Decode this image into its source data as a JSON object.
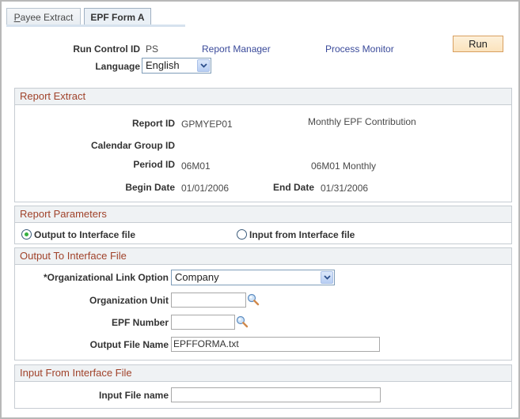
{
  "tabs": [
    {
      "label_prefix": "P",
      "label_rest": "ayee Extract",
      "active": false
    },
    {
      "label": "EPF Form A",
      "active": true
    }
  ],
  "header": {
    "run_control_label": "Run Control ID",
    "run_control_value": "PS",
    "report_manager_link": "Report Manager",
    "process_monitor_link": "Process Monitor",
    "language_label": "Language",
    "language_value": "English",
    "run_button": "Run"
  },
  "report_extract": {
    "title": "Report Extract",
    "report_id_label": "Report ID",
    "report_id_value": "GPMYEP01",
    "report_description": "Monthly EPF Contribution",
    "calendar_group_label": "Calendar Group ID",
    "calendar_group_value": "",
    "period_id_label": "Period ID",
    "period_id_value": "06M01",
    "period_description": "06M01 Monthly",
    "begin_date_label": "Begin Date",
    "begin_date_value": "01/01/2006",
    "end_date_label": "End Date",
    "end_date_value": "01/31/2006"
  },
  "report_parameters": {
    "title": "Report Parameters",
    "options": [
      {
        "label": "Output to Interface file",
        "selected": true
      },
      {
        "label": "Input from Interface file",
        "selected": false
      }
    ]
  },
  "output_section": {
    "title": "Output To Interface File",
    "org_link_label": "*Organizational Link Option",
    "org_link_value": "Company",
    "org_unit_label": "Organization Unit",
    "org_unit_value": "",
    "epf_number_label": "EPF Number",
    "epf_number_value": "",
    "output_file_label": "Output File Name",
    "output_file_value": "EPFFORMA.txt"
  },
  "input_section": {
    "title": "Input From Interface File",
    "input_file_label": "Input File name",
    "input_file_value": ""
  },
  "colors": {
    "section_title": "#a0422a",
    "link": "#3a4a9a",
    "run_button_bg": "#fbe3bd",
    "radio_selected": "#35b040"
  }
}
